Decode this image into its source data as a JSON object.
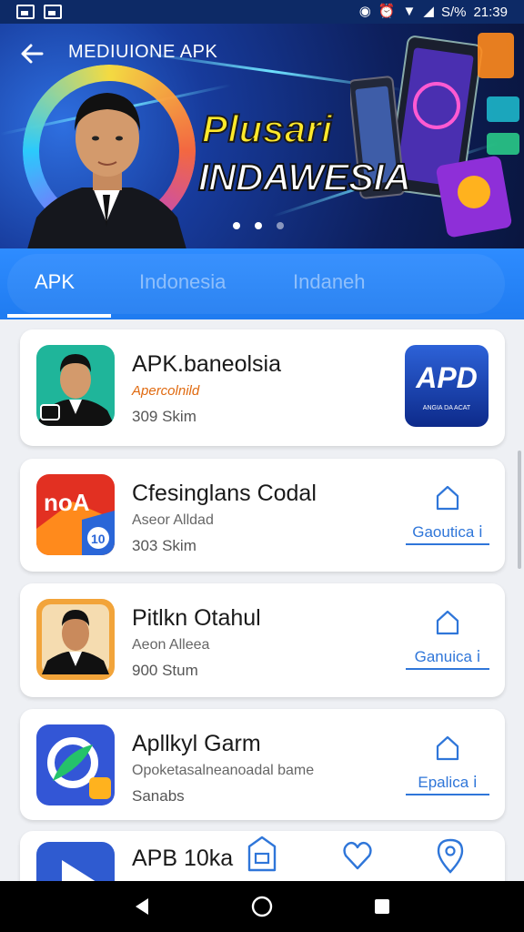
{
  "status_bar": {
    "time": "21:39",
    "battery": "S/% "
  },
  "hero": {
    "back_icon": "arrow-left-icon",
    "title": "MEDIUIONE APK",
    "headline_line1": "Plusari",
    "headline_line2": "INDAWESIA",
    "carousel_pages": 3,
    "carousel_active": 1
  },
  "tabs": [
    {
      "label": "APK",
      "active": true
    },
    {
      "label": "Indonesia",
      "active": false
    },
    {
      "label": "Indaneh",
      "active": false
    }
  ],
  "apps": [
    {
      "name": "APK.baneolsia",
      "subtitle": "Apercolnild",
      "size": "309 Skim",
      "action_type": "badge",
      "badge_text": "APD",
      "badge_caption": "ANGIA DA ACAT"
    },
    {
      "name": "Cfesinglans Codal",
      "subtitle": "Aseor Alldad",
      "size": "303 Skim",
      "action_type": "install",
      "action_label": "Gaoutica ⅰ"
    },
    {
      "name": "Pitlkn Otahul",
      "subtitle": "Aeon Alleea",
      "size": "900 Stum",
      "action_type": "install",
      "action_label": "Ganuica ⅰ"
    },
    {
      "name": "Apllkyl Garm",
      "subtitle": "Opoketasalneanoadal bame",
      "size": "Sanabs",
      "action_type": "install",
      "action_label": "Epalica ⅰ"
    },
    {
      "name": "APB 10ka",
      "subtitle": "",
      "size": "",
      "action_type": "none"
    }
  ],
  "bottom_icons": [
    "store-icon",
    "heart-icon",
    "location-icon"
  ],
  "nav": [
    "back-triangle-icon",
    "home-circle-icon",
    "recents-square-icon"
  ],
  "colors": {
    "accent": "#2f76d9",
    "tab_bg": "#1f7bf0",
    "hero_bg": "#0d1f5c"
  }
}
